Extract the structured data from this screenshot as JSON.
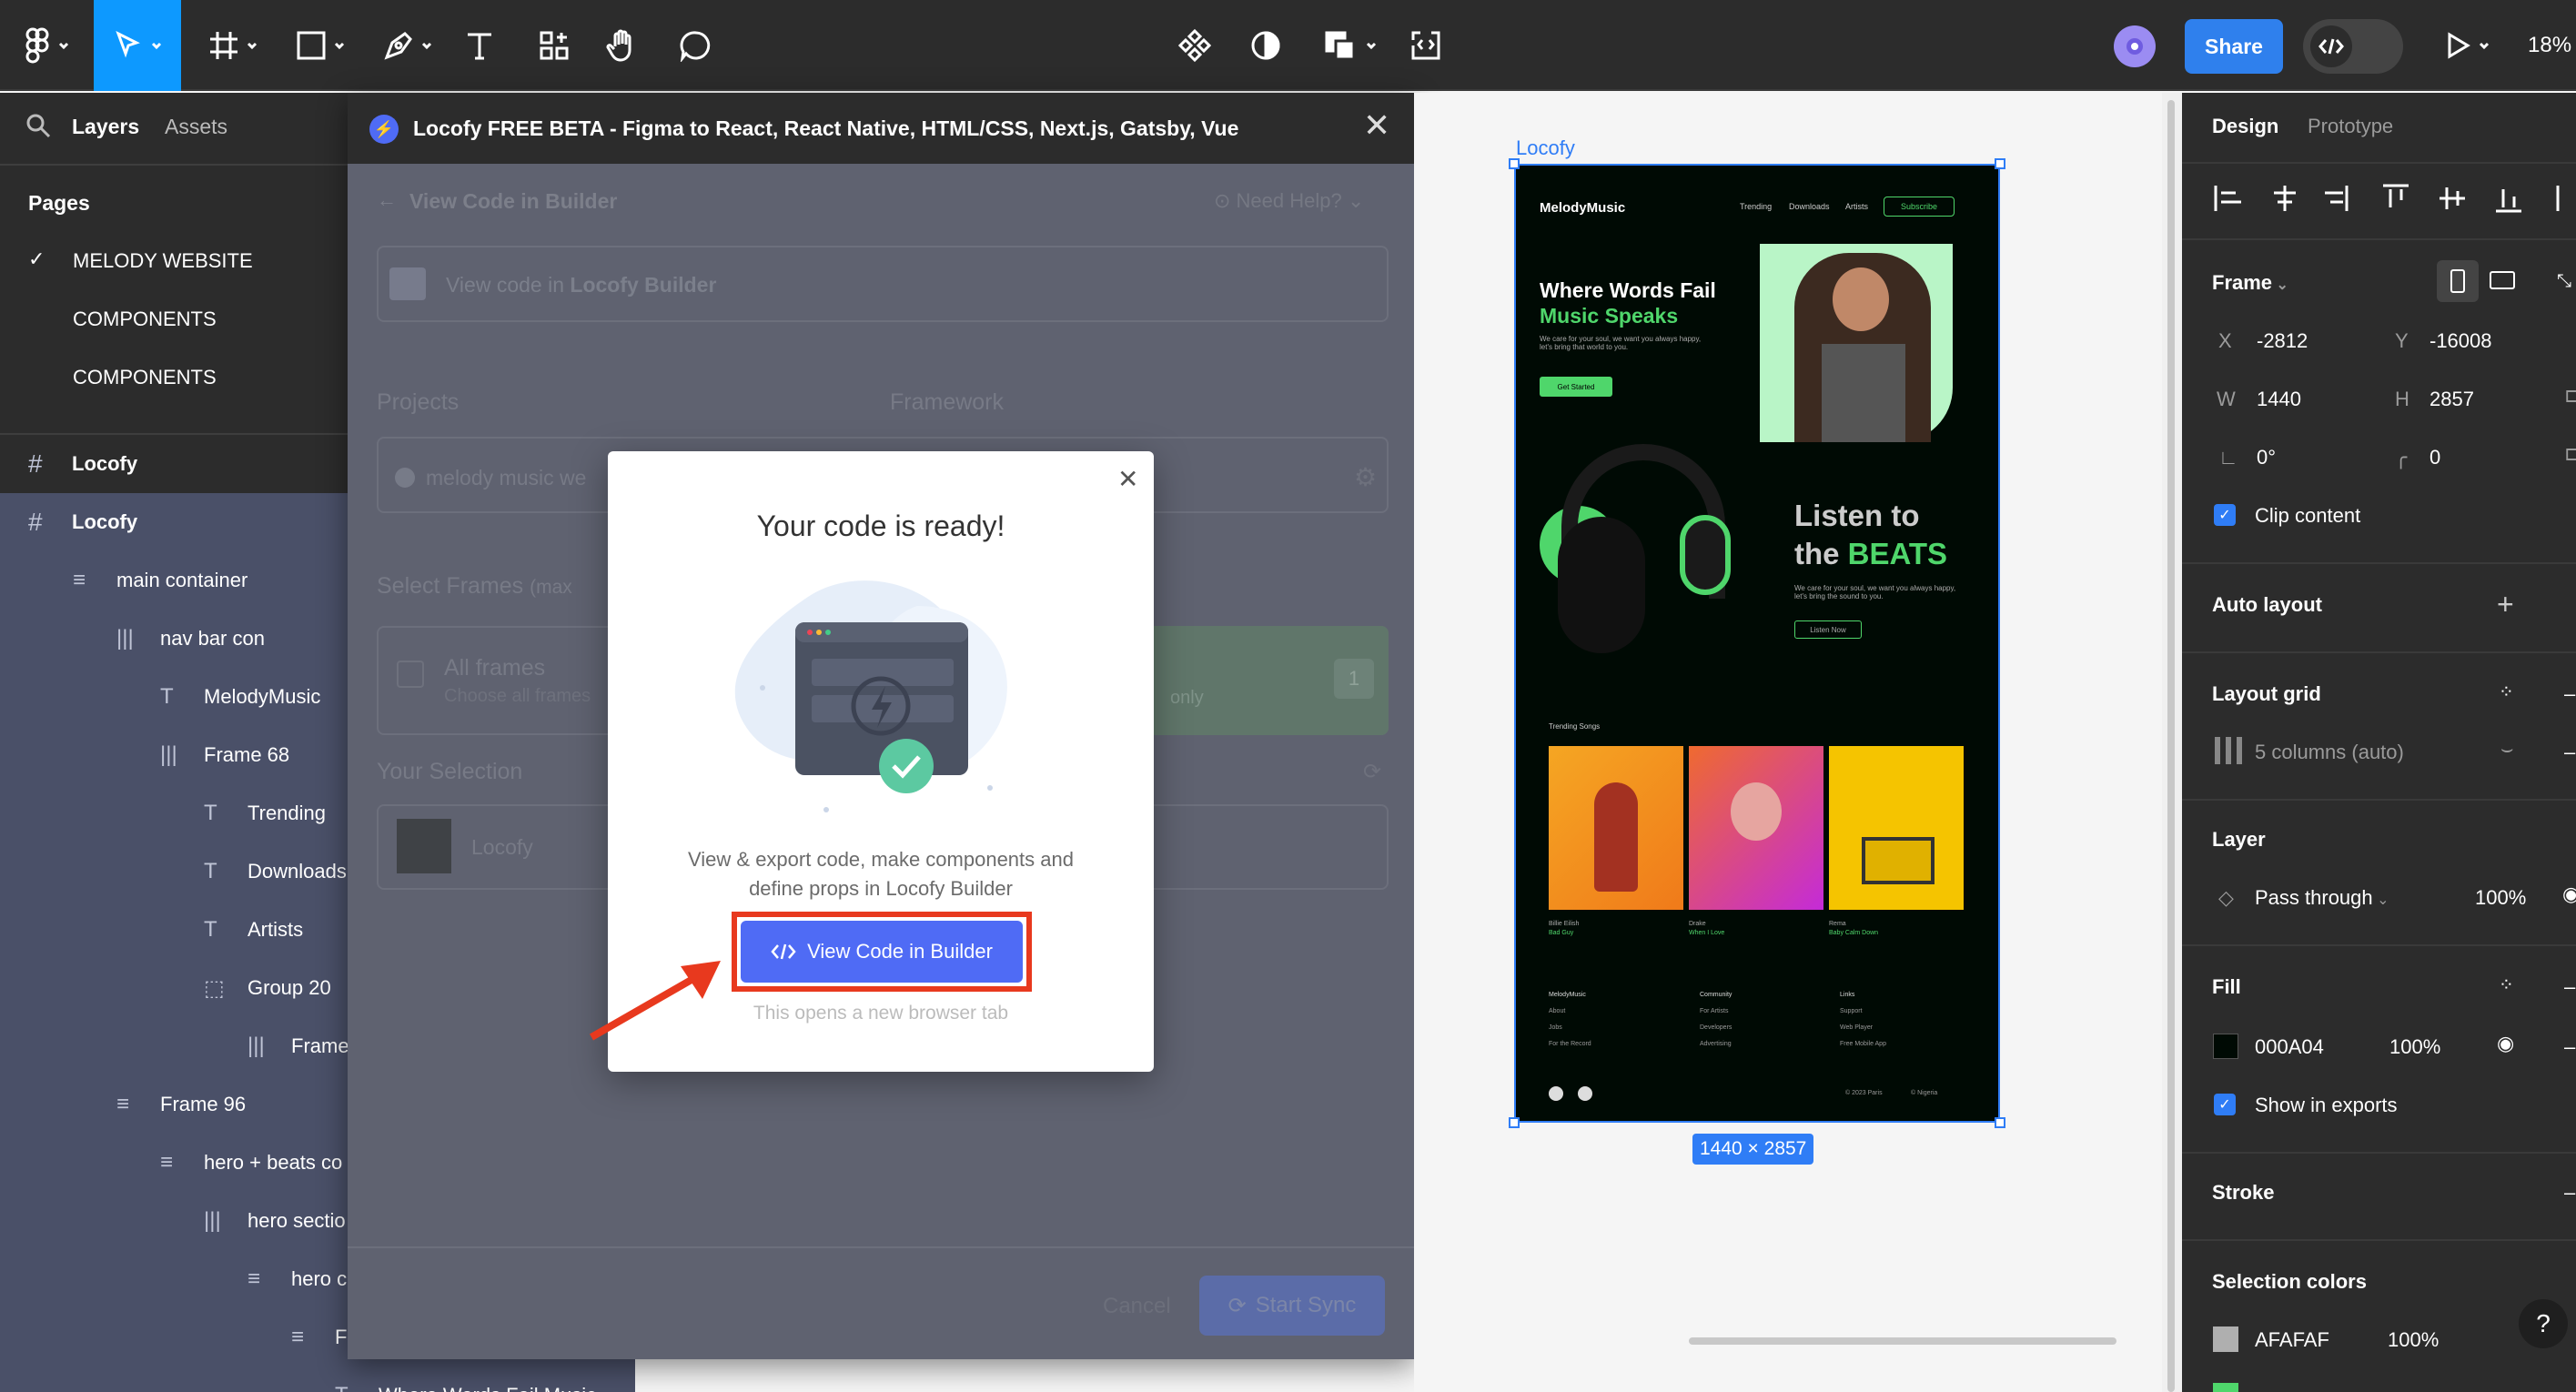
{
  "toolbar": {
    "share_label": "Share",
    "zoom": "18%"
  },
  "left_panel": {
    "tab_layers": "Layers",
    "tab_assets": "Assets",
    "pages_title": "Pages",
    "pages": [
      "MELODY WEBSITE",
      "COMPONENTS",
      "COMPONENTS"
    ],
    "layers": [
      {
        "label": "Locofy",
        "icon": "#"
      },
      {
        "label": "Locofy",
        "icon": "#"
      },
      {
        "label": "main container",
        "icon": "≡"
      },
      {
        "label": "nav bar con",
        "icon": "|||"
      },
      {
        "label": "MelodyMusic",
        "icon": "T"
      },
      {
        "label": "Frame 68",
        "icon": "|||"
      },
      {
        "label": "Trending",
        "icon": "T"
      },
      {
        "label": "Downloads",
        "icon": "T"
      },
      {
        "label": "Artists",
        "icon": "T"
      },
      {
        "label": "Group 20",
        "icon": "⬚"
      },
      {
        "label": "Frame",
        "icon": "|||"
      },
      {
        "label": "Frame 96",
        "icon": "≡"
      },
      {
        "label": "hero + beats co",
        "icon": "≡"
      },
      {
        "label": "hero sectio",
        "icon": "|||"
      },
      {
        "label": "hero c",
        "icon": "≡"
      },
      {
        "label": "F",
        "icon": "≡"
      },
      {
        "label": "Where Words Fail Music",
        "icon": "T"
      }
    ]
  },
  "plugin": {
    "title": "Locofy FREE BETA - Figma to React, React Native, HTML/CSS, Next.js, Gatsby, Vue",
    "header": "View Code in Builder",
    "need_help": "Need Help?",
    "view_code_prefix": "View code in ",
    "view_code_bold": "Locofy Builder",
    "projects_label": "Projects",
    "framework_label": "Framework",
    "project_value": "melody music we",
    "select_frames": "Select Frames",
    "select_frames_hint": "(max",
    "all_frames": "All frames",
    "all_frames_sub": "Choose all frames",
    "only": "only",
    "count": "1",
    "your_selection": "Your Selection",
    "selection_item": "Locofy",
    "cancel": "Cancel",
    "start_sync": "Start Sync"
  },
  "modal": {
    "title": "Your code is ready!",
    "description_line1": "View & export code, make components and",
    "description_line2": "define props in Locofy Builder",
    "button": "View Code in Builder",
    "note": "This opens a new browser tab"
  },
  "canvas": {
    "frame_label": "Locofy",
    "size_badge": "1440 × 2857",
    "preview": {
      "brand": "MelodyMusic",
      "nav": [
        "Trending",
        "Downloads",
        "Artists"
      ],
      "subscribe": "Subscribe",
      "hero_line1": "Where Words Fail",
      "hero_line2": "Music Speaks",
      "hero_body": "We care for your soul, we want you always happy, let's bring that world to you.",
      "get_started": "Get Started",
      "listen_line1": "Listen to",
      "listen_line2_a": "the ",
      "listen_line2_b": "BEATS",
      "listen_body": "We care for your soul, we want you always happy, let's bring the sound to you.",
      "listen_now": "Listen Now",
      "trending_title": "Trending Songs",
      "songs": [
        {
          "artist": "Billie Eilish",
          "title": "Bad Guy"
        },
        {
          "artist": "Drake",
          "title": "When I Love"
        },
        {
          "artist": "Rema",
          "title": "Baby Calm Down"
        }
      ],
      "footer_cols": [
        {
          "head": "MelodyMusic",
          "items": [
            "About",
            "Jobs",
            "For the Record"
          ]
        },
        {
          "head": "Community",
          "items": [
            "For Artists",
            "Developers",
            "Advertising"
          ]
        },
        {
          "head": "Links",
          "items": [
            "Support",
            "Web Player",
            "Free Mobile App"
          ]
        }
      ],
      "copyright": "© 2023 Paris",
      "location": "© Nigeria"
    }
  },
  "right_panel": {
    "tab_design": "Design",
    "tab_prototype": "Prototype",
    "frame_label": "Frame",
    "x_label": "X",
    "x_value": "-2812",
    "y_label": "Y",
    "y_value": "-16008",
    "w_label": "W",
    "w_value": "1440",
    "h_label": "H",
    "h_value": "2857",
    "rotation": "0°",
    "radius": "0",
    "clip_content": "Clip content",
    "auto_layout": "Auto layout",
    "layout_grid": "Layout grid",
    "grid_value": "5 columns (auto)",
    "layer": "Layer",
    "blend": "Pass through",
    "layer_opacity": "100%",
    "fill": "Fill",
    "fill_hex": "000A04",
    "fill_opacity": "100%",
    "show_in_exports": "Show in exports",
    "stroke": "Stroke",
    "selection_colors": "Selection colors",
    "sel_hex": "AFAFAF",
    "sel_opacity": "100%",
    "help": "?"
  },
  "colors": {
    "accent": "#0d99ff",
    "share": "#2f80ed",
    "locofy_blue": "#4f6bf5",
    "highlight_red": "#e8391e",
    "music_green": "#4fd66b",
    "frame_bg": "#000a04"
  }
}
